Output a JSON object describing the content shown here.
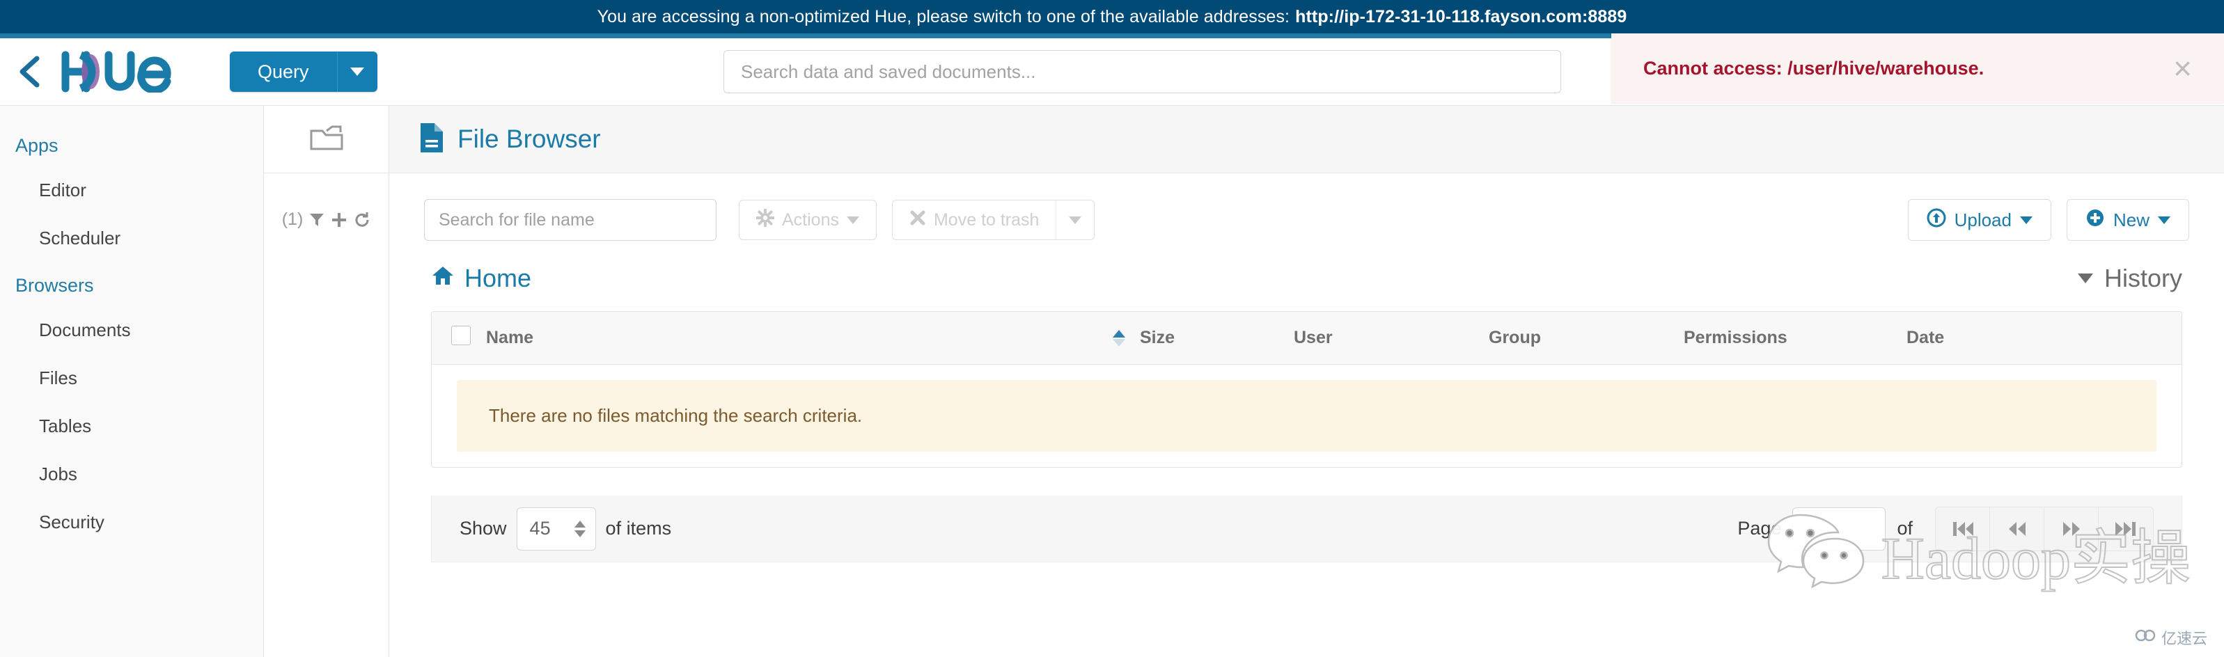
{
  "banner": {
    "message": "You are accessing a non-optimized Hue, please switch to one of the available addresses:",
    "url": "http://ip-172-31-10-118.fayson.com:8889"
  },
  "header": {
    "back_label": "back-chevron",
    "logo_text": "Hue",
    "query_button": "Query",
    "search_placeholder": "Search data and saved documents..."
  },
  "toast": {
    "message": "Cannot access: /user/hive/warehouse.",
    "close_label": "×"
  },
  "sidebar": {
    "groups": [
      {
        "title": "Apps",
        "items": [
          {
            "label": "Editor"
          },
          {
            "label": "Scheduler"
          }
        ]
      },
      {
        "title": "Browsers",
        "items": [
          {
            "label": "Documents"
          },
          {
            "label": "Files"
          },
          {
            "label": "Tables"
          },
          {
            "label": "Jobs"
          },
          {
            "label": "Security"
          }
        ]
      }
    ]
  },
  "assist": {
    "count_label": "(1)",
    "filter_icon": "filter-icon",
    "add_icon": "plus-icon",
    "refresh_icon": "refresh-icon",
    "panel_icon": "folder-icon"
  },
  "page": {
    "title": "File Browser",
    "title_icon": "file-document-icon"
  },
  "toolbar": {
    "file_search_placeholder": "Search for file name",
    "actions_label": "Actions",
    "trash_label": "Move to trash",
    "upload_label": "Upload",
    "new_label": "New"
  },
  "breadcrumb": {
    "home_label": "Home",
    "history_label": "History"
  },
  "table": {
    "columns": [
      {
        "label": "Name",
        "sorted": false
      },
      {
        "label": "Size",
        "sorted": true
      },
      {
        "label": "User",
        "sorted": false
      },
      {
        "label": "Group",
        "sorted": false
      },
      {
        "label": "Permissions",
        "sorted": false
      },
      {
        "label": "Date",
        "sorted": false
      }
    ],
    "rows": [],
    "empty_message": "There are no files matching the search criteria."
  },
  "pager": {
    "show_label": "Show",
    "page_size": "45",
    "of_items_label": "of items",
    "page_label": "Page",
    "page_value": "",
    "of_label": "of",
    "first_icon": "first-page-icon",
    "prev_icon": "previous-page-icon",
    "next_icon": "next-page-icon",
    "last_icon": "last-page-icon"
  },
  "watermark": {
    "text": "Hadoop实操",
    "badge_text": "亿速云"
  },
  "colors": {
    "banner_bg": "#004a75",
    "accent": "#217ba4",
    "brand_blue": "#147eb3",
    "error_red": "#a4142c",
    "warning_bg": "#fdf5e3"
  }
}
